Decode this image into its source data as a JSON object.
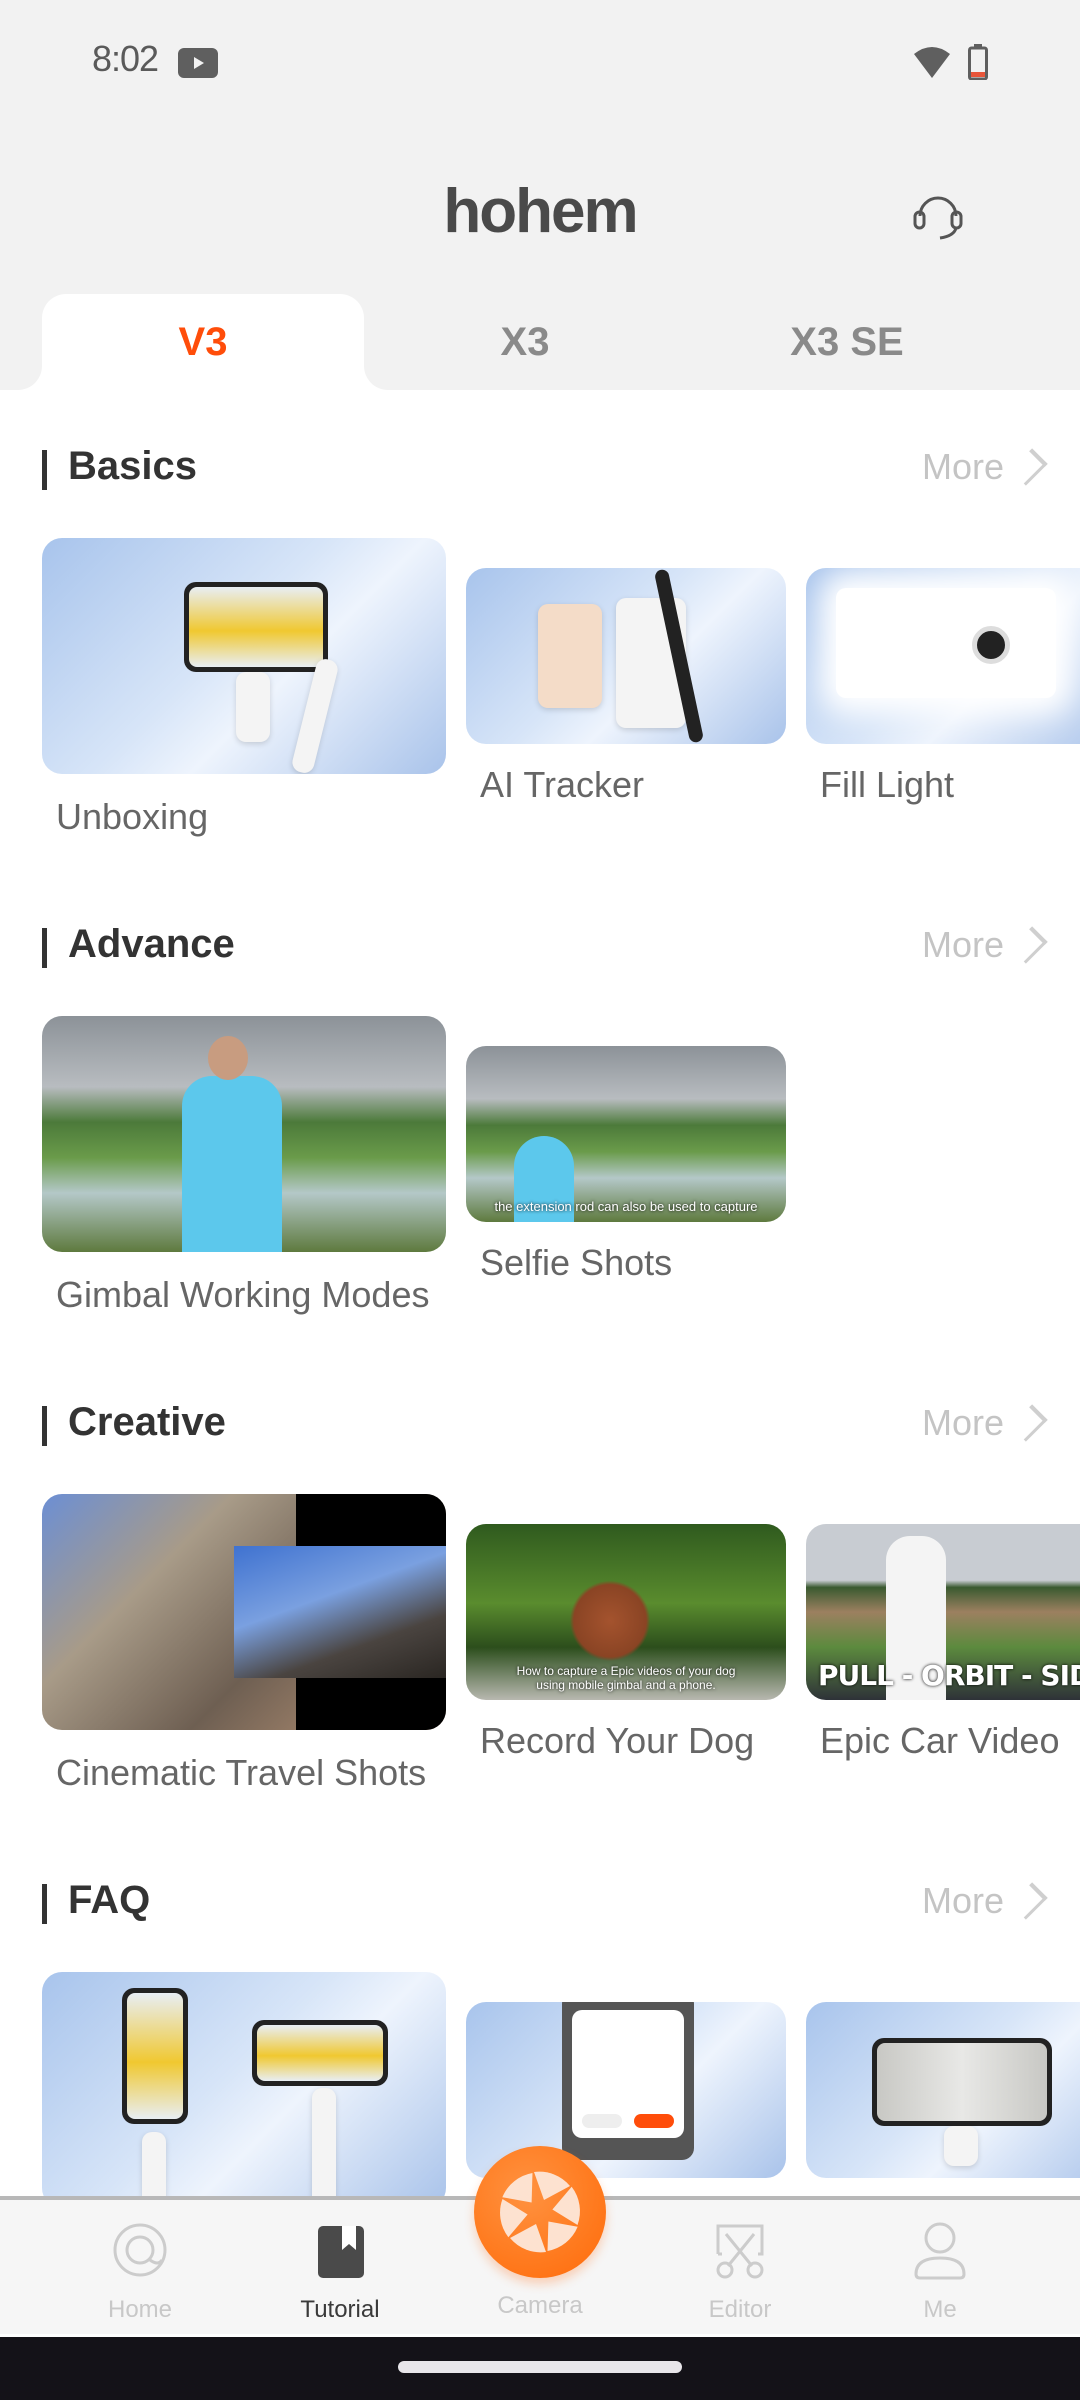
{
  "status_bar": {
    "time": "8:02",
    "icons": [
      "youtube-notification-icon",
      "wifi-icon",
      "battery-low-icon"
    ],
    "battery_level_color": "#e8553a"
  },
  "header": {
    "logo_text": "hohem",
    "support_icon": "headset-icon"
  },
  "tabs": [
    {
      "label": "V3",
      "active": true
    },
    {
      "label": "X3",
      "active": false
    },
    {
      "label": "X3 SE",
      "active": false
    }
  ],
  "accent_color": "#ff4d0a",
  "sections": [
    {
      "title": "Basics",
      "more_label": "More",
      "items": [
        {
          "label": "Unboxing"
        },
        {
          "label": "AI Tracker"
        },
        {
          "label": "Fill Light"
        }
      ]
    },
    {
      "title": "Advance",
      "more_label": "More",
      "items": [
        {
          "label": "Gimbal Working Modes"
        },
        {
          "label": "Selfie Shots",
          "caption": "the extension rod can also be used to capture"
        }
      ]
    },
    {
      "title": "Creative",
      "more_label": "More",
      "items": [
        {
          "label": "Cinematic Travel Shots"
        },
        {
          "label": "Record Your Dog",
          "caption": "How to capture a Epic videos of your dog using mobile gimbal and a phone."
        },
        {
          "label": "Epic Car Video",
          "caption": "PULL - ORBIT - SIDE SH"
        }
      ]
    },
    {
      "title": "FAQ",
      "more_label": "More",
      "items": [
        {
          "label": ""
        },
        {
          "label": ""
        },
        {
          "label": ""
        }
      ]
    }
  ],
  "bottom_nav": [
    {
      "label": "Home",
      "icon": "home-icon",
      "active": false
    },
    {
      "label": "Tutorial",
      "icon": "tutorial-book-icon",
      "active": true
    },
    {
      "label": "Camera",
      "icon": "camera-shutter-icon",
      "active": false
    },
    {
      "label": "Editor",
      "icon": "editor-scissors-icon",
      "active": false
    },
    {
      "label": "Me",
      "icon": "profile-icon",
      "active": false
    }
  ]
}
